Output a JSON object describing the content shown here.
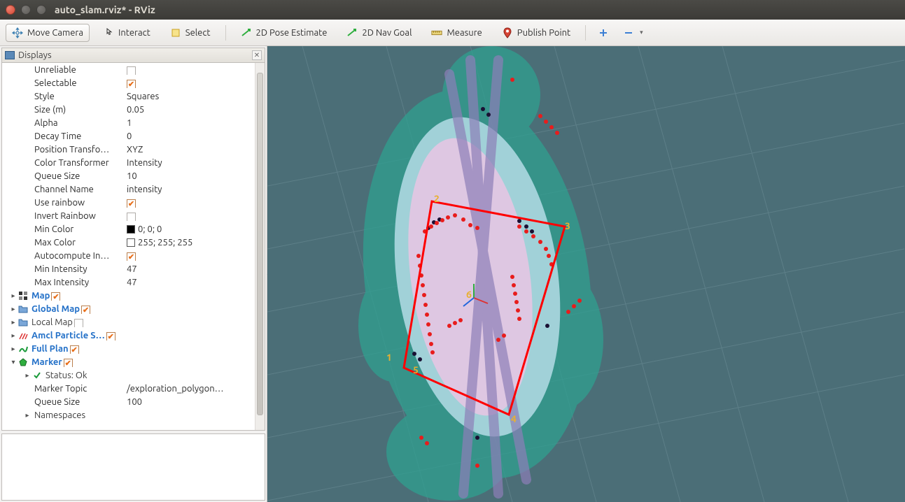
{
  "window": {
    "title": "auto_slam.rviz* - RViz"
  },
  "toolbar": {
    "move_camera": "Move Camera",
    "interact": "Interact",
    "select": "Select",
    "pose_estimate": "2D Pose Estimate",
    "nav_goal": "2D Nav Goal",
    "measure": "Measure",
    "publish_point": "Publish Point"
  },
  "panel": {
    "title": "Displays"
  },
  "props": {
    "unreliable": {
      "label": "Unreliable",
      "checked": false
    },
    "selectable": {
      "label": "Selectable",
      "checked": true
    },
    "style": {
      "label": "Style",
      "value": "Squares"
    },
    "size": {
      "label": "Size (m)",
      "value": "0.05"
    },
    "alpha": {
      "label": "Alpha",
      "value": "1"
    },
    "decay": {
      "label": "Decay Time",
      "value": "0"
    },
    "pos_transform": {
      "label": "Position Transfo…",
      "value": "XYZ"
    },
    "color_transform": {
      "label": "Color Transformer",
      "value": "Intensity"
    },
    "queue": {
      "label": "Queue Size",
      "value": "10"
    },
    "channel": {
      "label": "Channel Name",
      "value": "intensity"
    },
    "use_rainbow": {
      "label": "Use rainbow",
      "checked": true
    },
    "invert_rainbow": {
      "label": "Invert Rainbow",
      "checked": false
    },
    "min_color": {
      "label": "Min Color",
      "value": "0; 0; 0",
      "swatch": "#000000"
    },
    "max_color": {
      "label": "Max Color",
      "value": "255; 255; 255",
      "swatch": "#ffffff"
    },
    "autocompute": {
      "label": "Autocompute In…",
      "checked": true
    },
    "min_intensity": {
      "label": "Min Intensity",
      "value": "47"
    },
    "max_intensity": {
      "label": "Max Intensity",
      "value": "47"
    }
  },
  "tree": {
    "map": {
      "label": "Map",
      "checked": true
    },
    "global_map": {
      "label": "Global Map",
      "checked": true
    },
    "local_map": {
      "label": "Local Map",
      "checked": false
    },
    "amcl": {
      "label": "Amcl Particle S…",
      "checked": true
    },
    "full_plan": {
      "label": "Full Plan",
      "checked": true
    },
    "marker": {
      "label": "Marker",
      "checked": true
    },
    "status": {
      "label": "Status: Ok"
    },
    "marker_topic": {
      "label": "Marker Topic",
      "value": "/exploration_polygon…"
    },
    "marker_queue": {
      "label": "Queue Size",
      "value": "100"
    },
    "namespaces": {
      "label": "Namespaces"
    }
  },
  "markers": {
    "l1": "1",
    "l2": "2",
    "l3": "3",
    "l4": "4",
    "l5": "5",
    "l6": "6"
  }
}
